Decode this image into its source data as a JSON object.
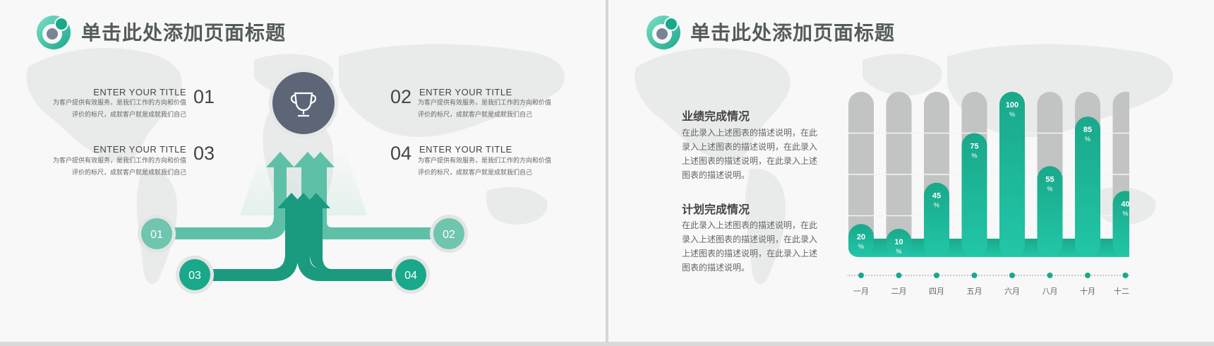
{
  "slide_left": {
    "title": "单击此处添加页面标题",
    "trophy_icon": "trophy-icon",
    "items": [
      {
        "num": "01",
        "title": "ENTER YOUR TITLE",
        "desc_line1": "为客户提供有效服务，是我们工作的方向和价值",
        "desc_line2": "评价的标尺，成就客户就是成就我们自己"
      },
      {
        "num": "02",
        "title": "ENTER YOUR TITLE",
        "desc_line1": "为客户提供有效服务，是我们工作的方向和价值",
        "desc_line2": "评价的标尺，成就客户就是成就我们自己"
      },
      {
        "num": "03",
        "title": "ENTER YOUR TITLE",
        "desc_line1": "为客户提供有效服务，是我们工作的方向和价值",
        "desc_line2": "评价的标尺，成就客户就是成就我们自己"
      },
      {
        "num": "04",
        "title": "ENTER YOUR TITLE",
        "desc_line1": "为客户提供有效服务，是我们工作的方向和价值",
        "desc_line2": "评价的标尺，成就客户就是成就我们自己"
      }
    ],
    "arrow_labels": [
      "01",
      "02",
      "03",
      "04"
    ]
  },
  "slide_right": {
    "title": "单击此处添加页面标题",
    "section1": {
      "heading": "业绩完成情况",
      "lines": [
        "在此录入上述图表的描述说明，在此",
        "录入上述图表的描述说明，在此录入",
        "上述图表的描述说明，在此录入上述",
        "图表的描述说明。"
      ]
    },
    "section2": {
      "heading": "计划完成情况",
      "lines": [
        "在此录入上述图表的描述说明，在此",
        "录入上述图表的描述说明，在此录入",
        "上述图表的描述说明，在此录入上述",
        "图表的描述说明。"
      ]
    }
  },
  "colors": {
    "accent": "#1aa88a",
    "accent_light": "#5fc0a8",
    "track": "#c2c3c3",
    "trophy": "#5d6677"
  },
  "chart_data": {
    "type": "bar",
    "categories": [
      "一月",
      "二月",
      "四月",
      "五月",
      "六月",
      "八月",
      "十月",
      "十二月"
    ],
    "values": [
      20,
      10,
      45,
      75,
      100,
      55,
      85,
      40
    ],
    "unit": "%",
    "ylim": [
      0,
      100
    ],
    "grid": true
  }
}
